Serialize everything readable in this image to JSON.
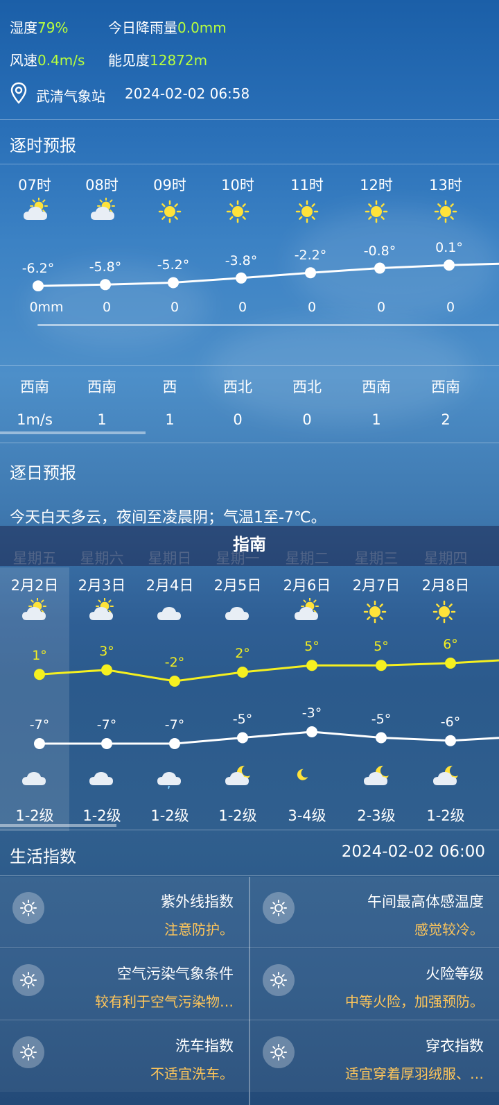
{
  "current": {
    "humidity_label": "湿度",
    "humidity_value": "79%",
    "rain_label": "今日降雨量",
    "rain_value": "0.0mm",
    "wind_label": "风速",
    "wind_value": "0.4m/s",
    "visibility_label": "能见度",
    "visibility_value": "12872m",
    "station": "武清气象站",
    "datetime": "2024-02-02 06:58",
    "highlight_color": "#b8ff3d"
  },
  "hourly": {
    "title": "逐时预报",
    "hours": [
      "07时",
      "08时",
      "09时",
      "10时",
      "11时",
      "12时",
      "13时"
    ],
    "icons": [
      "partly-cloudy-icon",
      "partly-cloudy-icon",
      "sun-icon",
      "sun-icon",
      "sun-icon",
      "sun-icon",
      "sun-icon"
    ],
    "temps": [
      "-6.2°",
      "-5.8°",
      "-5.2°",
      "-3.8°",
      "-2.2°",
      "-0.8°",
      "0.1°"
    ],
    "temp_values": [
      -6.2,
      -5.8,
      -5.2,
      -3.8,
      -2.2,
      -0.8,
      0.1
    ],
    "rain": [
      "0mm",
      "0",
      "0",
      "0",
      "0",
      "0",
      "0"
    ],
    "wind_dirs": [
      "西南",
      "西南",
      "西",
      "西北",
      "西北",
      "西南",
      "西南"
    ],
    "wind_speeds": [
      "1m/s",
      "1",
      "1",
      "0",
      "0",
      "1",
      "2"
    ]
  },
  "daily": {
    "title": "逐日预报",
    "summary": "今天白天多云，夜间至凌晨阴；气温1至-7℃。",
    "overlay_title": "指南",
    "weekdays": [
      "星期五",
      "星期六",
      "星期日",
      "星期一",
      "星期二",
      "星期三",
      "星期四"
    ],
    "dates": [
      "2月2日",
      "2月3日",
      "2月4日",
      "2月5日",
      "2月6日",
      "2月7日",
      "2月8日"
    ],
    "day_icons": [
      "partly-cloudy-icon",
      "partly-cloudy-icon",
      "cloud-icon",
      "cloud-icon",
      "partly-cloudy-icon",
      "sun-icon",
      "sun-icon"
    ],
    "highs": [
      "1°",
      "3°",
      "-2°",
      "2°",
      "5°",
      "5°",
      "6°"
    ],
    "high_values": [
      1,
      3,
      -2,
      2,
      5,
      5,
      6
    ],
    "lows": [
      "-7°",
      "-7°",
      "-7°",
      "-5°",
      "-3°",
      "-5°",
      "-6°"
    ],
    "low_values": [
      -7,
      -7,
      -7,
      -5,
      -3,
      -5,
      -6
    ],
    "night_icons": [
      "cloud-icon",
      "cloud-icon",
      "light-rain-icon",
      "cloud-moon-icon",
      "moon-icon",
      "cloud-moon-icon",
      "cloud-moon-icon"
    ],
    "winds": [
      "1-2级",
      "1-2级",
      "1-2级",
      "1-2级",
      "3-4级",
      "2-3级",
      "1-2级"
    ],
    "high_color": "#f5f020"
  },
  "life": {
    "title": "生活指数",
    "datetime": "2024-02-02 06:00",
    "cards": [
      {
        "title": "紫外线指数",
        "value": "注意防护。"
      },
      {
        "title": "午间最高体感温度",
        "value": "感觉较冷。"
      },
      {
        "title": "空气污染气象条件",
        "value": "较有利于空气污染物…"
      },
      {
        "title": "火险等级",
        "value": "中等火险，加强预防。"
      },
      {
        "title": "洗车指数",
        "value": "不适宜洗车。"
      },
      {
        "title": "穿衣指数",
        "value": "适宜穿着厚羽绒服、…"
      }
    ],
    "value_color": "#ffc65a"
  }
}
